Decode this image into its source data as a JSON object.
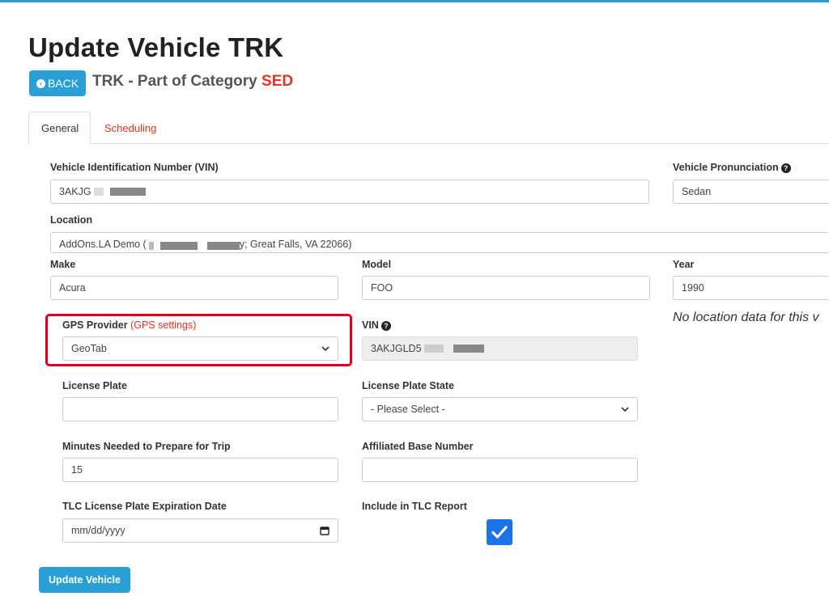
{
  "page": {
    "title": "Update Vehicle TRK",
    "back_label": "BACK",
    "subtitle_prefix": "TRK - Part of Category ",
    "category": "SED"
  },
  "tabs": [
    {
      "label": "General",
      "active": true
    },
    {
      "label": "Scheduling",
      "active": false
    }
  ],
  "form": {
    "vin_label": "Vehicle Identification Number (VIN)",
    "vin_value": "3AKJG",
    "pronunciation_label": "Vehicle Pronunciation",
    "pronunciation_value": "Sedan",
    "location_label": "Location",
    "location_value_prefix": "AddOns.LA Demo (",
    "location_value_suffix": "y; Great Falls, VA 22066)",
    "make_label": "Make",
    "make_value": "Acura",
    "model_label": "Model",
    "model_value": "FOO",
    "year_label": "Year",
    "year_value": "1990",
    "gps_provider_label": "GPS Provider",
    "gps_settings_link": "(GPS settings)",
    "gps_provider_value": "GeoTab",
    "vin_ro_label": "VIN",
    "vin_ro_value": "3AKJGLD5",
    "no_location_note": "No location data for this v",
    "license_plate_label": "License Plate",
    "license_plate_value": "",
    "license_plate_state_label": "License Plate State",
    "license_plate_state_value": "- Please Select -",
    "minutes_label": "Minutes Needed to Prepare for Trip",
    "minutes_value": "15",
    "affiliated_base_label": "Affiliated Base Number",
    "affiliated_base_value": "",
    "tlc_exp_label": "TLC License Plate Expiration Date",
    "tlc_exp_placeholder": "mm/dd/yyyy",
    "tlc_report_label": "Include in TLC Report",
    "tlc_report_checked": true,
    "submit_label": "Update Vehicle"
  },
  "colors": {
    "accent": "#2a9fd6",
    "danger": "#e2341e",
    "highlight_border": "#e0001b",
    "checkbox": "#1a73e8"
  }
}
